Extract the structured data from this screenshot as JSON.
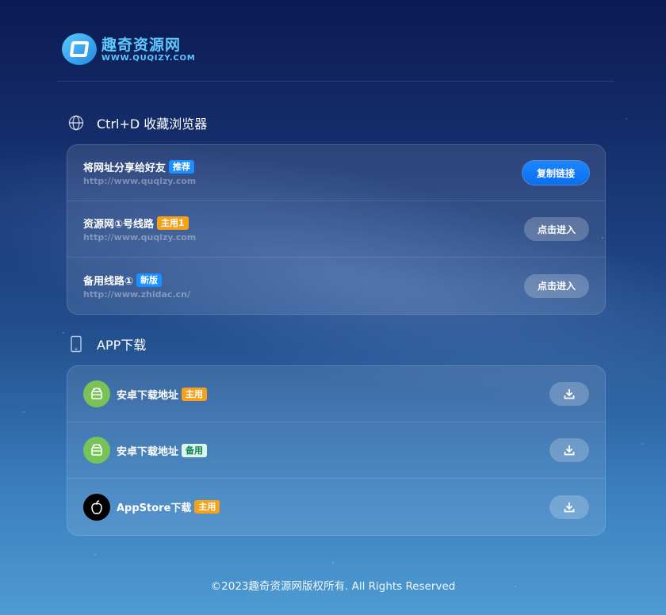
{
  "brand": {
    "name_cn": "趣奇资源网",
    "name_en": "WWW.QUQIZY.COM"
  },
  "bookmark_section": {
    "title": "Ctrl+D 收藏浏览器",
    "icon": "globe-icon",
    "rows": [
      {
        "title": "将网址分享给好友",
        "badge": "推荐",
        "badge_color": "#1b8fff",
        "url": "http://www.quqizy.com",
        "button": "复制链接"
      },
      {
        "title": "资源网①号线路",
        "badge": "主用1",
        "badge_color": "#f6a11a",
        "url": "http://www.quqizy.com",
        "button": "点击进入"
      },
      {
        "title": "备用线路①",
        "badge": "新版",
        "badge_color": "#1b8fff",
        "url": "http://www.zhidac.cn/",
        "button": "点击进入"
      }
    ]
  },
  "app_section": {
    "title": "APP下载",
    "icon": "phone-icon",
    "rows": [
      {
        "title": "安卓下载地址",
        "badge": "主用",
        "icon": "android-icon",
        "button_icon": "download-icon"
      },
      {
        "title": "安卓下载地址",
        "badge": "备用",
        "icon": "android-icon",
        "button_icon": "download-icon"
      },
      {
        "title": "AppStore下载",
        "badge": "主用",
        "icon": "apple-icon",
        "button_icon": "download-icon"
      }
    ]
  },
  "footer": {
    "text": "©2023趣奇资源网版权所有. All Rights Reserved"
  },
  "colors": {
    "accent": "#1b8fff",
    "badge_orange": "#f6a11a",
    "badge_mint": "#d8f6ea",
    "android_green": "#78c257"
  }
}
